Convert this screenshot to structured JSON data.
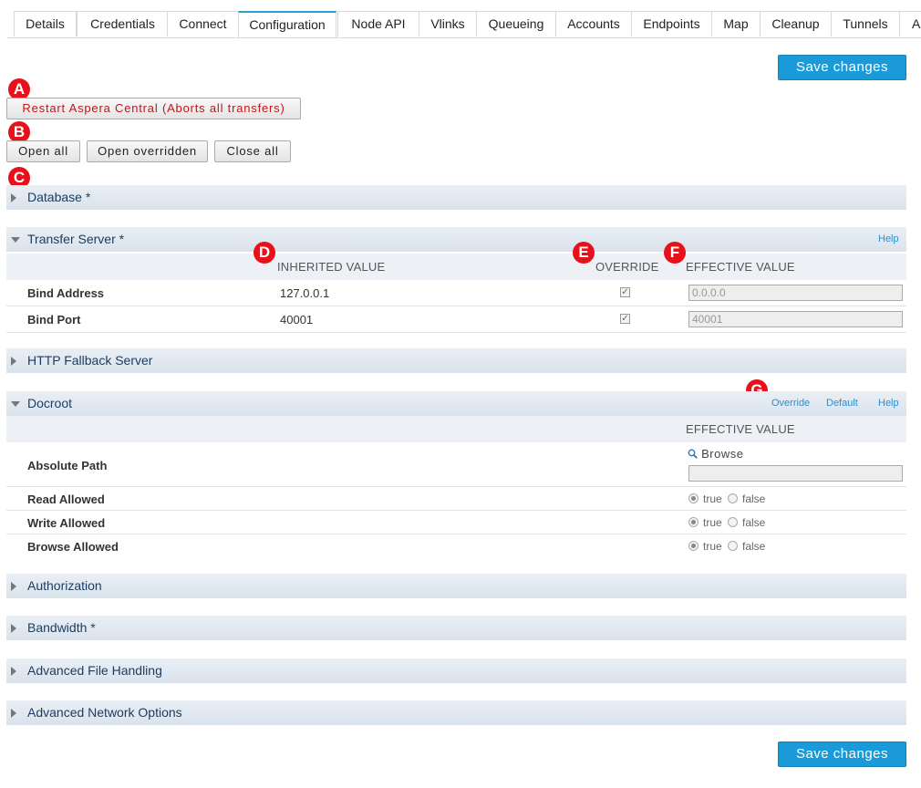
{
  "tabs": [
    "Details",
    "Credentials",
    "Connect",
    "Configuration",
    "Node API",
    "Vlinks",
    "Queueing",
    "Accounts",
    "Endpoints",
    "Map",
    "Cleanup",
    "Tunnels",
    "Al"
  ],
  "active_tab": "Configuration",
  "save_label": "Save changes",
  "restart_label": "Restart Aspera Central (Aborts all transfers)",
  "open_all_label": "Open all",
  "open_overridden_label": "Open overridden",
  "close_all_label": "Close all",
  "markers": [
    "A",
    "B",
    "C",
    "D",
    "E",
    "F",
    "G"
  ],
  "accent_color": "#1a9ad9",
  "sections": {
    "database": "Database *",
    "transfer_server": "Transfer Server *",
    "http_fallback": "HTTP Fallback Server",
    "docroot": "Docroot",
    "authorization": "Authorization",
    "bandwidth": "Bandwidth *",
    "advanced_file": "Advanced File Handling",
    "advanced_network": "Advanced Network Options"
  },
  "links": {
    "help": "Help",
    "override": "Override",
    "default": "Default"
  },
  "columns": {
    "inherited": "INHERITED VALUE",
    "override": "OVERRIDE",
    "effective": "EFFECTIVE VALUE"
  },
  "transfer_rows": [
    {
      "label": "Bind Address",
      "inherited": "127.0.0.1",
      "override_checked": true,
      "effective_placeholder": "0.0.0.0"
    },
    {
      "label": "Bind Port",
      "inherited": "40001",
      "override_checked": true,
      "effective_placeholder": "40001"
    }
  ],
  "docroot": {
    "absolute_path_label": "Absolute Path",
    "browse_label": "Browse",
    "read_label": "Read Allowed",
    "write_label": "Write Allowed",
    "browse_allowed_label": "Browse Allowed",
    "true_label": "true",
    "false_label": "false",
    "read_value": "true",
    "write_value": "true",
    "browse_value": "true"
  }
}
